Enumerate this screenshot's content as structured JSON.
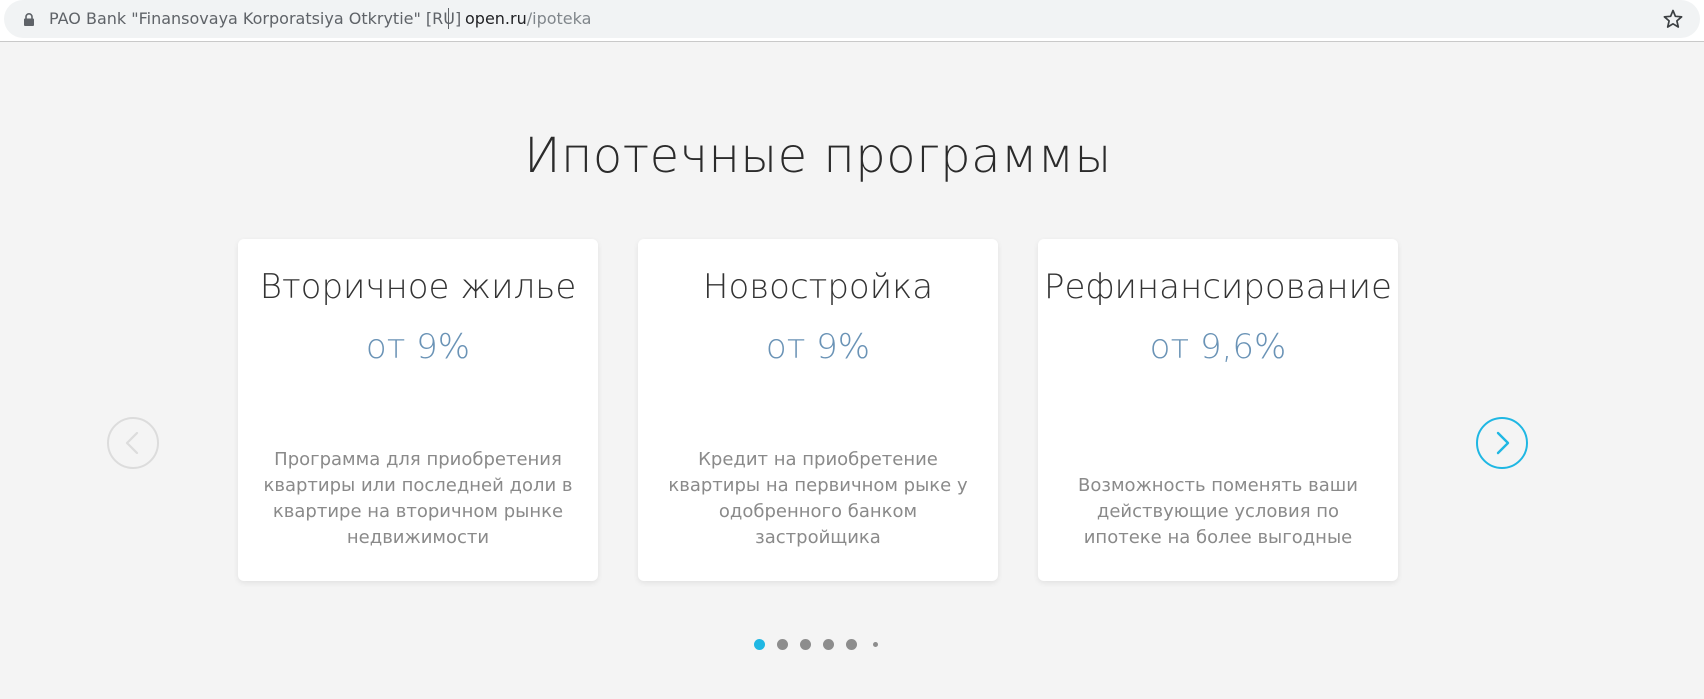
{
  "browser": {
    "cert_name": "PAO Bank \"Finansovaya Korporatsiya Otkrytie\" [RU]",
    "url_host": "open.ru",
    "url_path": "/ipoteka"
  },
  "page": {
    "title": "Ипотечные программы"
  },
  "cards": [
    {
      "title": "Вторичное жилье",
      "rate": "от 9%",
      "description": "Программа для приобретения квартиры или последней доли в квартире на вторичном рынке недвижимости"
    },
    {
      "title": "Новостройка",
      "rate": "от 9%",
      "description": "Кредит на приобретение квартиры на первичном рыке у одобренного банком застройщика"
    },
    {
      "title": "Рефинансирование",
      "rate": "от 9,6%",
      "description": "Возможность поменять ваши действующие условия по ипотеке на более выгодные"
    }
  ],
  "carousel": {
    "page_count": 6,
    "active_page": 1
  },
  "colors": {
    "accent": "#1fb7e3",
    "rate": "#6a93b6",
    "background": "#f4f4f4"
  },
  "icons": {
    "lock": "lock-icon",
    "star": "star-icon",
    "prev": "chevron-left-icon",
    "next": "chevron-right-icon"
  }
}
